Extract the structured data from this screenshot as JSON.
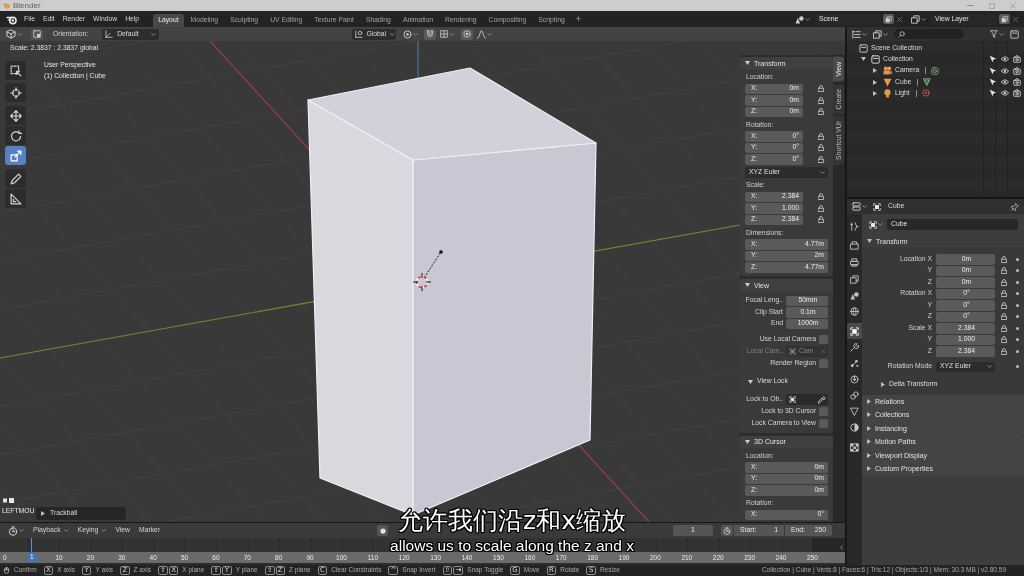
{
  "window": {
    "title": "Blender"
  },
  "menu": [
    "File",
    "Edit",
    "Render",
    "Window",
    "Help"
  ],
  "workspaces": [
    {
      "label": "Layout",
      "selected": true
    },
    {
      "label": "Modeling",
      "selected": false
    },
    {
      "label": "Sculpting",
      "selected": false
    },
    {
      "label": "UV Editing",
      "selected": false
    },
    {
      "label": "Texture Paint",
      "selected": false
    },
    {
      "label": "Shading",
      "selected": false
    },
    {
      "label": "Animation",
      "selected": false
    },
    {
      "label": "Rendering",
      "selected": false
    },
    {
      "label": "Compositing",
      "selected": false
    },
    {
      "label": "Scripting",
      "selected": false
    }
  ],
  "add_workspace": "+",
  "scene": "Scene",
  "view_layer": "View Layer",
  "viewport": {
    "orientation_label": "Orientation:",
    "orientation": "Default",
    "transform_orientation": "Global",
    "operator_info": "Scale: 2.3837 : 2.3837 global",
    "view_name": "User Perspective",
    "object_info": "(1) Collection | Cube",
    "tools": [
      {
        "kind": "select_box",
        "selected": false
      },
      {
        "kind": "cursor",
        "selected": false
      },
      {
        "kind": "move",
        "selected": false
      },
      {
        "kind": "rotate",
        "selected": false
      },
      {
        "kind": "scale",
        "selected": true
      },
      {
        "kind": "annotate",
        "selected": false
      },
      {
        "kind": "measure",
        "selected": false
      }
    ],
    "event_text": "LEFTMOU",
    "last_operator": {
      "title": "Trackball",
      "expanded": false
    }
  },
  "sidebar": {
    "tabs": [
      {
        "label": "View",
        "selected": true
      },
      {
        "label": "Create",
        "selected": false
      },
      {
        "label": "Shortcut VUr",
        "selected": false
      }
    ],
    "panels": [
      {
        "title": "Transform",
        "expanded": true,
        "rows": [
          {
            "kind": "heading",
            "text": "Location:"
          },
          {
            "kind": "vector",
            "label": "X:",
            "value": "0m",
            "locked": false
          },
          {
            "kind": "vector",
            "label": "Y:",
            "value": "0m",
            "locked": false
          },
          {
            "kind": "vector",
            "label": "Z:",
            "value": "0m",
            "locked": false
          },
          {
            "kind": "heading",
            "text": "Rotation:"
          },
          {
            "kind": "vector",
            "label": "X:",
            "value": "0°",
            "locked": false
          },
          {
            "kind": "vector",
            "label": "Y:",
            "value": "0°",
            "locked": false
          },
          {
            "kind": "vector",
            "label": "Z:",
            "value": "0°",
            "locked": false
          },
          {
            "kind": "dropdown",
            "value": "XYZ Euler"
          },
          {
            "kind": "heading",
            "text": "Scale:"
          },
          {
            "kind": "vector",
            "label": "X:",
            "value": "2.384",
            "locked": false
          },
          {
            "kind": "vector",
            "label": "Y:",
            "value": "1.000",
            "locked": false
          },
          {
            "kind": "vector",
            "label": "Z:",
            "value": "2.384",
            "locked": false
          },
          {
            "kind": "heading",
            "text": "Dimensions:"
          },
          {
            "kind": "vector",
            "label": "X:",
            "value": "4.77m"
          },
          {
            "kind": "vector",
            "label": "Y:",
            "value": "2m"
          },
          {
            "kind": "vector",
            "label": "Z:",
            "value": "4.77m"
          }
        ]
      },
      {
        "title": "View",
        "expanded": true,
        "rows": [
          {
            "kind": "property",
            "label": "Focal Leng..",
            "value": "50mm"
          },
          {
            "kind": "property",
            "label": "Clip Start",
            "value": "0.1m"
          },
          {
            "kind": "property",
            "label": "End",
            "value": "1000m"
          },
          {
            "kind": "checkbox",
            "label": "Use Local Camera",
            "checked": false
          },
          {
            "kind": "object",
            "label": "Local Cam..",
            "value": "Cam",
            "disabled": true
          },
          {
            "kind": "checkbox",
            "label": "Render Region",
            "checked": false
          },
          {
            "kind": "subpanel",
            "title": "View Lock",
            "expanded": true
          },
          {
            "kind": "picker",
            "label": "Lock to Ob..",
            "disabled": false
          },
          {
            "kind": "checkbox",
            "label": "Lock to 3D Cursor",
            "checked": false
          },
          {
            "kind": "checkbox",
            "label": "Lock Camera to View",
            "checked": false
          }
        ]
      },
      {
        "title": "3D Cursor",
        "expanded": true,
        "rows": [
          {
            "kind": "heading",
            "text": "Location:"
          },
          {
            "kind": "vector",
            "label": "X:",
            "value": "0m"
          },
          {
            "kind": "vector",
            "label": "Y:",
            "value": "0m"
          },
          {
            "kind": "vector",
            "label": "Z:",
            "value": "0m"
          },
          {
            "kind": "heading",
            "text": "Rotation:"
          },
          {
            "kind": "vector",
            "label": "X:",
            "value": "0°"
          }
        ]
      }
    ]
  },
  "outliner": {
    "tree": [
      {
        "name": "Scene Collection",
        "kind": "scene_collection",
        "children": [
          {
            "name": "Collection",
            "kind": "collection",
            "expanded": true,
            "selectable": true,
            "visible": true,
            "renderable": true,
            "children": [
              {
                "name": "Camera",
                "kind": "camera",
                "expanded": false,
                "selectable": true,
                "visible": true,
                "renderable": true
              },
              {
                "name": "Cube",
                "kind": "mesh",
                "expanded": false,
                "selectable": true,
                "visible": true,
                "renderable": true
              },
              {
                "name": "Light",
                "kind": "light",
                "expanded": false,
                "selectable": true,
                "visible": true,
                "renderable": true
              }
            ]
          }
        ]
      }
    ]
  },
  "properties": {
    "context": "Cube",
    "object_name": "Cube",
    "tabs": [
      {
        "kind": "tool",
        "selected": false
      },
      {
        "kind": "render",
        "selected": false
      },
      {
        "kind": "output",
        "selected": false
      },
      {
        "kind": "view_layer",
        "selected": false
      },
      {
        "kind": "scene",
        "selected": false
      },
      {
        "kind": "world",
        "selected": false
      },
      {
        "kind": "object",
        "selected": true
      },
      {
        "kind": "modifiers",
        "selected": false
      },
      {
        "kind": "particles",
        "selected": false
      },
      {
        "kind": "physics",
        "selected": false
      },
      {
        "kind": "constraints",
        "selected": false
      },
      {
        "kind": "data",
        "selected": false
      },
      {
        "kind": "material",
        "selected": false
      },
      {
        "kind": "texture",
        "selected": false
      }
    ],
    "panels": [
      {
        "title": "Transform",
        "expanded": true,
        "rows": [
          {
            "kind": "property",
            "label": "Location X",
            "value": "0m",
            "locked": false,
            "keyed": false
          },
          {
            "kind": "property",
            "label": "Y",
            "value": "0m",
            "locked": false,
            "keyed": false
          },
          {
            "kind": "property",
            "label": "Z",
            "value": "0m",
            "locked": false,
            "keyed": false
          },
          {
            "kind": "property",
            "label": "Rotation X",
            "value": "0°",
            "locked": false,
            "keyed": false
          },
          {
            "kind": "property",
            "label": "Y",
            "value": "0°",
            "locked": false,
            "keyed": false
          },
          {
            "kind": "property",
            "label": "Z",
            "value": "0°",
            "locked": false,
            "keyed": false
          },
          {
            "kind": "property",
            "label": "Scale X",
            "value": "2.384",
            "locked": false,
            "keyed": false
          },
          {
            "kind": "property",
            "label": "Y",
            "value": "1.000",
            "locked": false,
            "keyed": false
          },
          {
            "kind": "property",
            "label": "Z",
            "value": "2.384",
            "locked": false,
            "keyed": false
          },
          {
            "kind": "dropdown",
            "label": "Rotation Mode",
            "value": "XYZ Euler",
            "keyed": false
          },
          {
            "kind": "subpanel",
            "title": "Delta Transform",
            "expanded": false
          }
        ]
      },
      {
        "title": "Relations",
        "expanded": false
      },
      {
        "title": "Collections",
        "expanded": false
      },
      {
        "title": "Instancing",
        "expanded": false
      },
      {
        "title": "Motion Paths",
        "expanded": false
      },
      {
        "title": "Viewport Display",
        "expanded": false
      },
      {
        "title": "Custom Properties",
        "expanded": false
      }
    ]
  },
  "timeline": {
    "menus": [
      {
        "label": "Playback",
        "caret": true
      },
      {
        "label": "Keying",
        "caret": true
      },
      {
        "label": "View",
        "caret": false
      },
      {
        "label": "Marker",
        "caret": false
      }
    ],
    "auto_keying": false,
    "current_frame": "1",
    "start_label": "Start:",
    "start": "1",
    "end_label": "End:",
    "end": "250",
    "playhead": "1",
    "frame_labels": [
      "0",
      "10",
      "20",
      "30",
      "40",
      "50",
      "60",
      "70",
      "80",
      "90",
      "100",
      "110",
      "120",
      "130",
      "140",
      "150",
      "160",
      "170",
      "180",
      "190",
      "200",
      "210",
      "220",
      "230",
      "240",
      "250"
    ]
  },
  "status_bar": {
    "hints": [
      {
        "kind": "mouse",
        "label": "Confirm"
      },
      {
        "kind": "keys",
        "keys": [
          "X"
        ],
        "label": "X axis"
      },
      {
        "kind": "keys",
        "keys": [
          "Y"
        ],
        "label": "Y axis"
      },
      {
        "kind": "keys",
        "keys": [
          "Z"
        ],
        "label": "Z axis"
      },
      {
        "kind": "keys",
        "keys": [
          "⇧",
          "X"
        ],
        "label": "X plane"
      },
      {
        "kind": "keys",
        "keys": [
          "⇧",
          "Y"
        ],
        "label": "Y plane"
      },
      {
        "kind": "keys",
        "keys": [
          "⇧",
          "Z"
        ],
        "label": "Z plane"
      },
      {
        "kind": "keys",
        "keys": [
          "C"
        ],
        "label": "Clear Constraints"
      },
      {
        "kind": "keys",
        "keys": [
          "^"
        ],
        "label": "Snap Invert"
      },
      {
        "kind": "keys",
        "keys": [
          "⇧",
          "⇥"
        ],
        "label": "Snap Toggle"
      },
      {
        "kind": "keys",
        "keys": [
          "G"
        ],
        "label": "Move"
      },
      {
        "kind": "keys",
        "keys": [
          "R"
        ],
        "label": "Rotate"
      },
      {
        "kind": "keys",
        "keys": [
          "S"
        ],
        "label": "Resize"
      }
    ],
    "stats": "Collection | Cube | Verts:8 | Faces:6 | Tris:12 | Objects:1/3 | Mem: 30.3 MB | v2.80.59"
  },
  "subtitles": [
    "允许我们沿z和x缩放",
    "allows us to scale along the z and x"
  ]
}
